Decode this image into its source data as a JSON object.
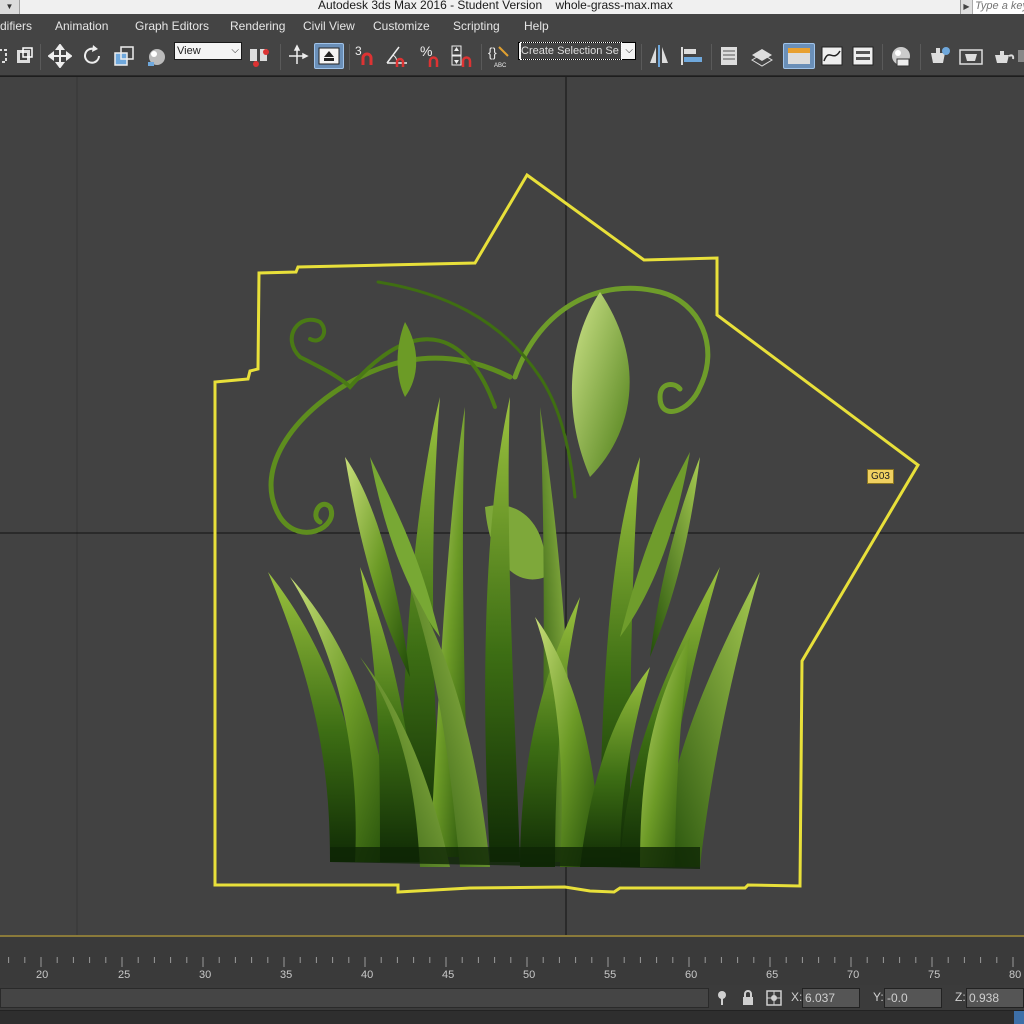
{
  "app": {
    "title": "Autodesk 3ds Max 2016 - Student Version    whole-grass-max.max",
    "search_placeholder": "Type a keyword or phrase"
  },
  "menu": {
    "items": [
      "difiers",
      "Animation",
      "Graph Editors",
      "Rendering",
      "Civil View",
      "Customize",
      "Scripting",
      "Help"
    ]
  },
  "toolbar": {
    "reference_coordinate": "View",
    "selection_set": "Create Selection Se",
    "snap_label": "3",
    "percent_label": "%",
    "abc_label": "ABC"
  },
  "viewport": {
    "object_label": "G03",
    "selection_color": "#e8e03a",
    "background_color": "#424242"
  },
  "timeline": {
    "ticks": [
      "20",
      "25",
      "30",
      "35",
      "40",
      "45",
      "50",
      "55",
      "60",
      "65",
      "70",
      "75",
      "80"
    ]
  },
  "status": {
    "x_label": "X:",
    "x_value": "6.037",
    "y_label": "Y:",
    "y_value": "-0.0",
    "z_label": "Z:",
    "z_value": "0.938"
  },
  "icons": [
    "lock-icon",
    "selection-lock-icon",
    "absolute-mode-icon",
    "move-icon",
    "rotate-icon",
    "scale-icon",
    "pivot-icon",
    "snap-icon",
    "angle-snap-icon",
    "percent-snap-icon",
    "spinner-snap-icon",
    "mirror-icon",
    "align-icon",
    "layer-explorer-icon",
    "scene-explorer-icon",
    "curve-editor-icon",
    "material-editor-icon",
    "render-setup-icon",
    "render-frame-icon",
    "render-icon"
  ]
}
